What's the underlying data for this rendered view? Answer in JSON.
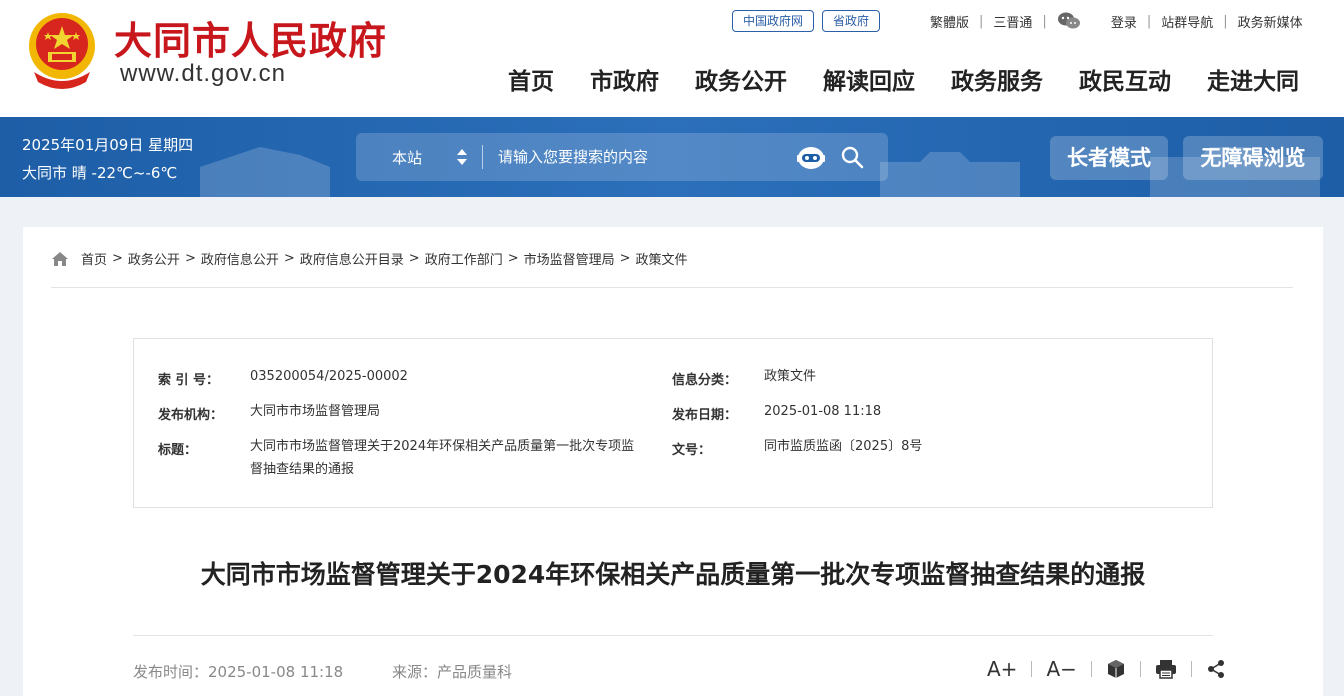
{
  "header": {
    "site_title": "大同市人民政府",
    "site_url": "www.dt.gov.cn",
    "tags": [
      "中国政府网",
      "省政府"
    ],
    "lang_links": [
      "繁體版",
      "三晋通"
    ],
    "user_links": [
      "登录",
      "站群导航",
      "政务新媒体"
    ],
    "nav": [
      "首页",
      "市政府",
      "政务公开",
      "解读回应",
      "政务服务",
      "政民互动",
      "走进大同"
    ]
  },
  "banner": {
    "date": "2025年01月09日 星期四",
    "weather": "大同市 晴 -22℃~-6℃",
    "scope": "本站",
    "search_placeholder": "请输入您要搜索的内容",
    "elder_mode": "长者模式",
    "accessible": "无障碍浏览"
  },
  "breadcrumb": [
    "首页",
    "政务公开",
    "政府信息公开",
    "政府信息公开目录",
    "政府工作部门",
    "市场监督管理局",
    "政策文件"
  ],
  "meta": {
    "index_label": "索 引 号：",
    "index_value": "035200054/2025-00002",
    "category_label": "信息分类：",
    "category_value": "政策文件",
    "org_label": "发布机构：",
    "org_value": "大同市市场监督管理局",
    "date_label": "发布日期：",
    "date_value": "2025-01-08 11:18",
    "title_label": "标题：",
    "title_value": "大同市市场监督管理关于2024年环保相关产品质量第一批次专项监督抽查结果的通报",
    "docno_label": "文号：",
    "docno_value": "同市监质监函〔2025〕8号"
  },
  "article": {
    "title": "大同市市场监督管理关于2024年环保相关产品质量第一批次专项监督抽查结果的通报",
    "publish_time": "发布时间：2025-01-08 11:18",
    "source": "来源：产品质量科",
    "font_up": "A+",
    "font_down": "A−"
  },
  "colors": {
    "brand_red": "#c8161d",
    "banner_blue": "#1d5ea7",
    "link_blue": "#2b5fa8"
  }
}
